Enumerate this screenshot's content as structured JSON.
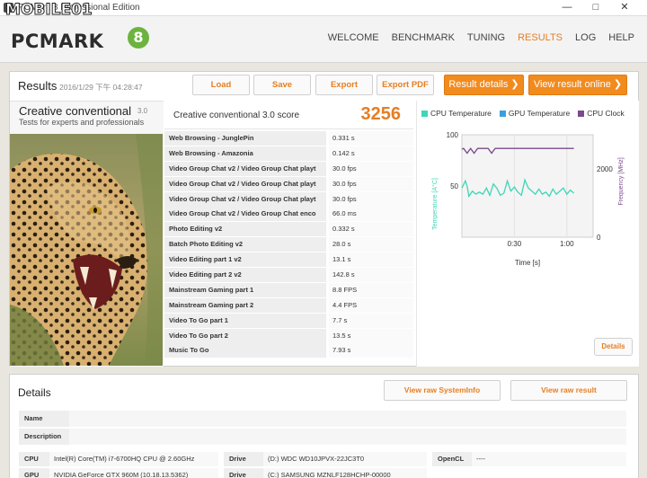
{
  "window": {
    "title": "PCMark 8 Professional Edition",
    "min": "—",
    "max": "□",
    "close": "✕"
  },
  "watermark": "MOBILE01",
  "brand": {
    "name": "PCMARK",
    "badge": "8"
  },
  "nav": {
    "items": [
      "WELCOME",
      "BENCHMARK",
      "TUNING",
      "RESULTS",
      "LOG",
      "HELP"
    ],
    "active": "RESULTS"
  },
  "results": {
    "title": "Results",
    "date": "2016/1/29 下午 04:28:47",
    "buttons": {
      "load": "Load",
      "save": "Save",
      "export": "Export",
      "export_pdf": "Export PDF"
    },
    "result_details": "Result details ❯",
    "view_online": "View result online ❯"
  },
  "preset": {
    "name": "Creative conventional",
    "version": "3.0",
    "subtitle": "Tests for experts and professionals"
  },
  "score": {
    "label": "Creative conventional 3.0 score",
    "value": "3256"
  },
  "tests": [
    {
      "name": "Web Browsing - JunglePin",
      "value": "0.331 s"
    },
    {
      "name": "Web Browsing - Amazonia",
      "value": "0.142 s"
    },
    {
      "name": "Video Group Chat v2 / Video Group Chat playt",
      "value": "30.0 fps"
    },
    {
      "name": "Video Group Chat v2 / Video Group Chat playt",
      "value": "30.0 fps"
    },
    {
      "name": "Video Group Chat v2 / Video Group Chat playt",
      "value": "30.0 fps"
    },
    {
      "name": "Video Group Chat v2 / Video Group Chat enco",
      "value": "66.0 ms"
    },
    {
      "name": "Photo Editing v2",
      "value": "0.332 s"
    },
    {
      "name": "Batch Photo Editing v2",
      "value": "28.0 s"
    },
    {
      "name": "Video Editing part 1 v2",
      "value": "13.1 s"
    },
    {
      "name": "Video Editing part 2 v2",
      "value": "142.8 s"
    },
    {
      "name": "Mainstream Gaming part 1",
      "value": "8.8 FPS"
    },
    {
      "name": "Mainstream Gaming part 2",
      "value": "4.4 FPS"
    },
    {
      "name": "Video To Go part 1",
      "value": "7.7 s"
    },
    {
      "name": "Video To Go part 2",
      "value": "13.5 s"
    },
    {
      "name": "Music To Go",
      "value": "7.93 s"
    }
  ],
  "chart_data": {
    "type": "line",
    "legend": [
      {
        "name": "CPU Temperature",
        "color": "#3ed6b7"
      },
      {
        "name": "GPU Temperature",
        "color": "#3aa0dc"
      },
      {
        "name": "CPU Clock",
        "color": "#7a4a8c"
      }
    ],
    "xlabel": "Time [s]",
    "ylabel_left": "Temperature [A°C]",
    "ylabel_right": "Frequency [MHz]",
    "x_ticks": [
      "0:30",
      "1:00"
    ],
    "y_left_ticks": [
      "100",
      "50"
    ],
    "y_right_ticks": [
      "2000",
      "0"
    ],
    "ylim_left": [
      0,
      100
    ],
    "ylim_right": [
      0,
      3000
    ],
    "xlim": [
      0,
      75
    ],
    "series": [
      {
        "name": "CPU Temperature",
        "axis": "left",
        "x": [
          0,
          2,
          3,
          4,
          6,
          8,
          10,
          12,
          14,
          16,
          18,
          20,
          22,
          24,
          26,
          28,
          30,
          32,
          34,
          36,
          38,
          40,
          42,
          44,
          46,
          48,
          50,
          52,
          54,
          56,
          58,
          60,
          62,
          64
        ],
        "values": [
          48,
          55,
          50,
          40,
          45,
          42,
          44,
          42,
          48,
          41,
          52,
          48,
          41,
          43,
          55,
          45,
          49,
          44,
          41,
          56,
          48,
          45,
          42,
          47,
          42,
          44,
          40,
          47,
          42,
          45,
          48,
          42,
          46,
          43
        ]
      },
      {
        "name": "CPU Clock",
        "axis": "right",
        "x": [
          0,
          1,
          3,
          5,
          7,
          9,
          11,
          13,
          15,
          17,
          19,
          21,
          23,
          25,
          27,
          29,
          31,
          33,
          35,
          37,
          64
        ],
        "values": [
          2580,
          2600,
          2460,
          2600,
          2460,
          2600,
          2600,
          2600,
          2600,
          2460,
          2600,
          2600,
          2600,
          2600,
          2600,
          2600,
          2600,
          2600,
          2600,
          2600,
          2600
        ]
      }
    ],
    "details": "Details"
  },
  "details": {
    "title": "Details",
    "view_sysinfo": "View raw SystemInfo",
    "view_result": "View raw result",
    "name_label": "Name",
    "description_label": "Description",
    "specs": {
      "cpu_label": "CPU",
      "cpu": "Intel(R) Core(TM) i7-6700HQ CPU @ 2.60GHz",
      "gpu_label": "GPU",
      "gpu": "NVIDIA GeForce GTX 960M (10.18.13.5362)",
      "drive1_label": "Drive",
      "drive1": "(D:) WDC WD10JPVX-22JC3T0",
      "drive2_label": "Drive",
      "drive2": "(C:) SAMSUNG MZNLF128HCHP-00000",
      "opencl_label": "OpenCL",
      "opencl": "----"
    }
  }
}
